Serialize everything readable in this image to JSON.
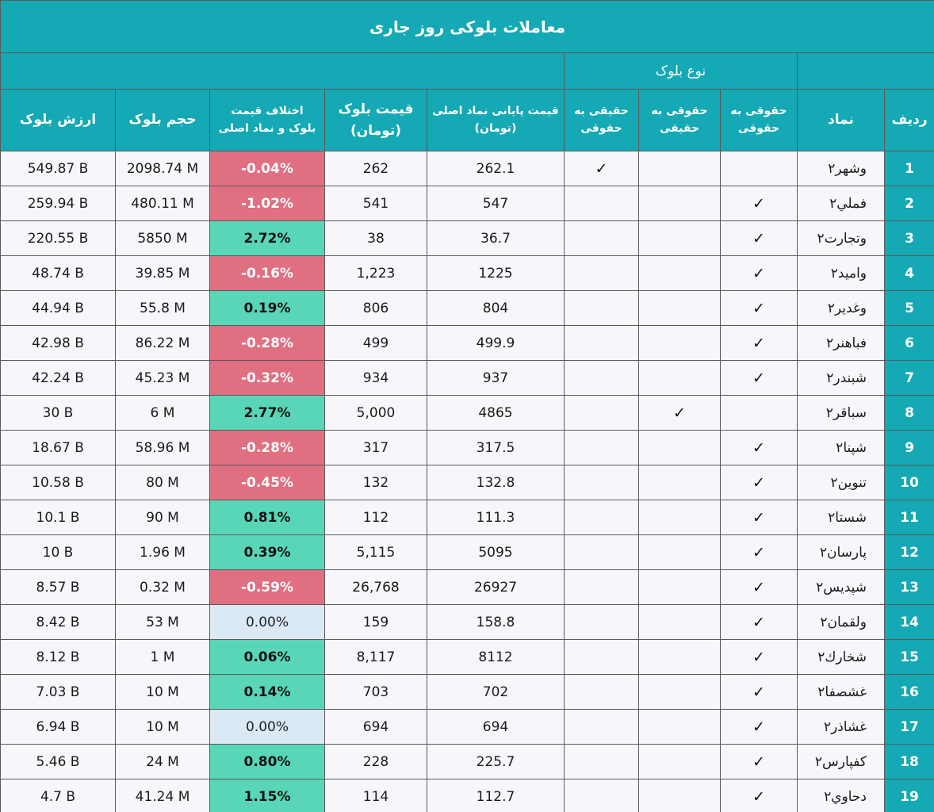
{
  "title": "معاملات بلوکی روز جاری",
  "group_header": "نوع بلوک",
  "colors": {
    "header_bg": "#14a9b4",
    "negative_bg": "#e06f82",
    "positive_bg": "#59d6b7",
    "zero_bg": "#dbe9f4"
  },
  "columns": {
    "row": "ردیف",
    "symbol": "نماد",
    "type1_line1": "حقوقی به",
    "type1_line2": "حقوقی",
    "type2_line1": "حقوقی به",
    "type2_line2": "حقیقی",
    "type3_line1": "حقیقی به",
    "type3_line2": "حقوقی",
    "close_line1": "قیمت پایانی نماد اصلی",
    "close_line2": "(تومان)",
    "block_price_line1": "قیمت بلوک",
    "block_price_line2": "(تومان)",
    "diff_line1": "اختلاف قیمت",
    "diff_line2": "بلوک و نماد اصلی",
    "volume": "حجم بلوک",
    "value": "ارزش بلوک"
  },
  "check_mark": "✓",
  "rows": [
    {
      "n": "1",
      "symbol": "وشهر۲",
      "type": 3,
      "close": "262.1",
      "price": "262",
      "diff": "-0.04%",
      "sign": "neg",
      "volume": "2098.74 M",
      "value": "549.87 B"
    },
    {
      "n": "2",
      "symbol": "فملي۲",
      "type": 1,
      "close": "547",
      "price": "541",
      "diff": "-1.02%",
      "sign": "neg",
      "volume": "480.11 M",
      "value": "259.94 B"
    },
    {
      "n": "3",
      "symbol": "وتجارت۲",
      "type": 1,
      "close": "36.7",
      "price": "38",
      "diff": "2.72%",
      "sign": "pos",
      "volume": "5850 M",
      "value": "220.55 B"
    },
    {
      "n": "4",
      "symbol": "واميد۲",
      "type": 1,
      "close": "1225",
      "price": "1,223",
      "diff": "-0.16%",
      "sign": "neg",
      "volume": "39.85 M",
      "value": "48.74 B"
    },
    {
      "n": "5",
      "symbol": "وغدير۲",
      "type": 1,
      "close": "804",
      "price": "806",
      "diff": "0.19%",
      "sign": "pos",
      "volume": "55.8 M",
      "value": "44.94 B"
    },
    {
      "n": "6",
      "symbol": "فباهنر۲",
      "type": 1,
      "close": "499.9",
      "price": "499",
      "diff": "-0.28%",
      "sign": "neg",
      "volume": "86.22 M",
      "value": "42.98 B"
    },
    {
      "n": "7",
      "symbol": "شبندر۲",
      "type": 1,
      "close": "937",
      "price": "934",
      "diff": "-0.32%",
      "sign": "neg",
      "volume": "45.23 M",
      "value": "42.24 B"
    },
    {
      "n": "8",
      "symbol": "سباقر۲",
      "type": 2,
      "close": "4865",
      "price": "5,000",
      "diff": "2.77%",
      "sign": "pos",
      "volume": "6 M",
      "value": "30 B"
    },
    {
      "n": "9",
      "symbol": "شپنا۲",
      "type": 1,
      "close": "317.5",
      "price": "317",
      "diff": "-0.28%",
      "sign": "neg",
      "volume": "58.96 M",
      "value": "18.67 B"
    },
    {
      "n": "10",
      "symbol": "تنوين۲",
      "type": 1,
      "close": "132.8",
      "price": "132",
      "diff": "-0.45%",
      "sign": "neg",
      "volume": "80 M",
      "value": "10.58 B"
    },
    {
      "n": "11",
      "symbol": "شستا۲",
      "type": 1,
      "close": "111.3",
      "price": "112",
      "diff": "0.81%",
      "sign": "pos",
      "volume": "90 M",
      "value": "10.1 B"
    },
    {
      "n": "12",
      "symbol": "پارسان۲",
      "type": 1,
      "close": "5095",
      "price": "5,115",
      "diff": "0.39%",
      "sign": "pos",
      "volume": "1.96 M",
      "value": "10 B"
    },
    {
      "n": "13",
      "symbol": "شپديس۲",
      "type": 1,
      "close": "26927",
      "price": "26,768",
      "diff": "-0.59%",
      "sign": "neg",
      "volume": "0.32 M",
      "value": "8.57 B"
    },
    {
      "n": "14",
      "symbol": "ولقمان۲",
      "type": 1,
      "close": "158.8",
      "price": "159",
      "diff": "0.00%",
      "sign": "zero",
      "volume": "53 M",
      "value": "8.42 B"
    },
    {
      "n": "15",
      "symbol": "شخارك۲",
      "type": 1,
      "close": "8112",
      "price": "8,117",
      "diff": "0.06%",
      "sign": "pos",
      "volume": "1 M",
      "value": "8.12 B"
    },
    {
      "n": "16",
      "symbol": "غشصفا۲",
      "type": 1,
      "close": "702",
      "price": "703",
      "diff": "0.14%",
      "sign": "pos",
      "volume": "10 M",
      "value": "7.03 B"
    },
    {
      "n": "17",
      "symbol": "غشاذر۲",
      "type": 1,
      "close": "694",
      "price": "694",
      "diff": "0.00%",
      "sign": "zero",
      "volume": "10 M",
      "value": "6.94 B"
    },
    {
      "n": "18",
      "symbol": "كفپارس۲",
      "type": 1,
      "close": "225.7",
      "price": "228",
      "diff": "0.80%",
      "sign": "pos",
      "volume": "24 M",
      "value": "5.46 B"
    },
    {
      "n": "19",
      "symbol": "دحاوي۲",
      "type": 1,
      "close": "112.7",
      "price": "114",
      "diff": "1.15%",
      "sign": "pos",
      "volume": "41.24 M",
      "value": "4.7 B"
    }
  ]
}
